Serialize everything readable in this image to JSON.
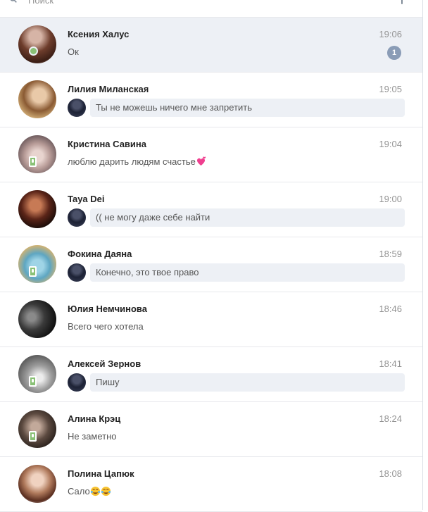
{
  "search": {
    "placeholder": "Поиск"
  },
  "dialogs": [
    {
      "name": "Ксения Халус",
      "time": "19:06",
      "preview": "Ок",
      "unread": "1"
    },
    {
      "name": "Лилия Миланская",
      "time": "19:05",
      "reply": "Ты не можешь ничего мне запретить"
    },
    {
      "name": "Кристина Савина",
      "time": "19:04",
      "preview": "люблю дарить людям счастье"
    },
    {
      "name": "Taya Dei",
      "time": "19:00",
      "reply": "(( не могу даже себе найти"
    },
    {
      "name": "Фокина Даяна",
      "time": "18:59",
      "reply": "Конечно, это твое право"
    },
    {
      "name": "Юлия Немчинова",
      "time": "18:46",
      "preview": "Всего чего хотела"
    },
    {
      "name": "Алексей Зернов",
      "time": "18:41",
      "reply": "Пишу"
    },
    {
      "name": "Алина Крэц",
      "time": "18:24",
      "preview": "Не заметно"
    },
    {
      "name": "Полина Цапюк",
      "time": "18:08",
      "preview": "Сало"
    }
  ],
  "icons": {
    "search": "search-icon",
    "online": "online-indicator",
    "mobile": "mobile-online-icon",
    "heart": "heart-emoji",
    "laugh": "tears-of-joy-emoji"
  },
  "colors": {
    "online": "#8ac176",
    "badge": "#8a9cb6",
    "active_row": "#edf0f5"
  }
}
